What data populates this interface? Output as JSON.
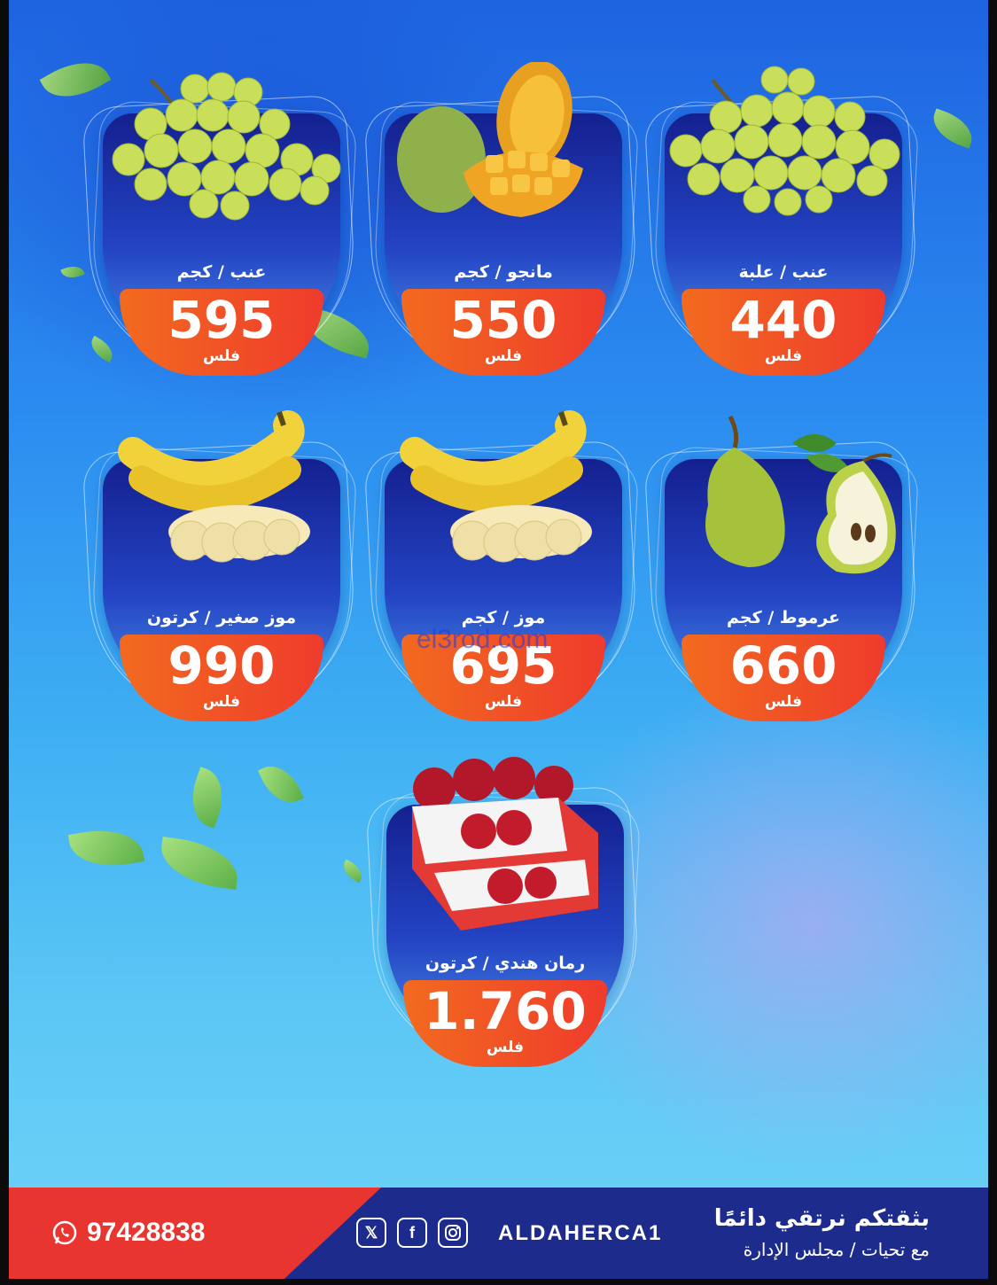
{
  "products": [
    {
      "name": "عنب / كجم",
      "price": "595",
      "unit": "فلس",
      "fruit": "grapes-icon"
    },
    {
      "name": "مانجو / كجم",
      "price": "550",
      "unit": "فلس",
      "fruit": "mango-icon"
    },
    {
      "name": "عنب / علبة",
      "price": "440",
      "unit": "فلس",
      "fruit": "grapes-icon"
    },
    {
      "name": "موز صغير / كرتون",
      "price": "990",
      "unit": "فلس",
      "fruit": "banana-icon"
    },
    {
      "name": "موز / كجم",
      "price": "695",
      "unit": "فلس",
      "fruit": "banana-icon"
    },
    {
      "name": "عرموط / كجم",
      "price": "660",
      "unit": "فلس",
      "fruit": "pear-icon"
    },
    {
      "name": "رمان هندي / كرتون",
      "price": "1.760",
      "unit": "فلس",
      "fruit": "pomegranate-box-icon"
    }
  ],
  "watermark": "el3rod.com",
  "footer": {
    "phone": "97428838",
    "handle": "ALDAHERCA1",
    "slogan": "بثقتكم نرتقي دائمًا",
    "sub": "مع تحيات / مجلس الإدارة",
    "social_icons": [
      "x-icon",
      "facebook-icon",
      "instagram-icon"
    ],
    "phone_icon": "whatsapp-icon"
  },
  "colors": {
    "badge": "#ef3b2c",
    "card": "#14208f",
    "footer": "#1d2c8c",
    "footer_accent": "#e8352f"
  }
}
